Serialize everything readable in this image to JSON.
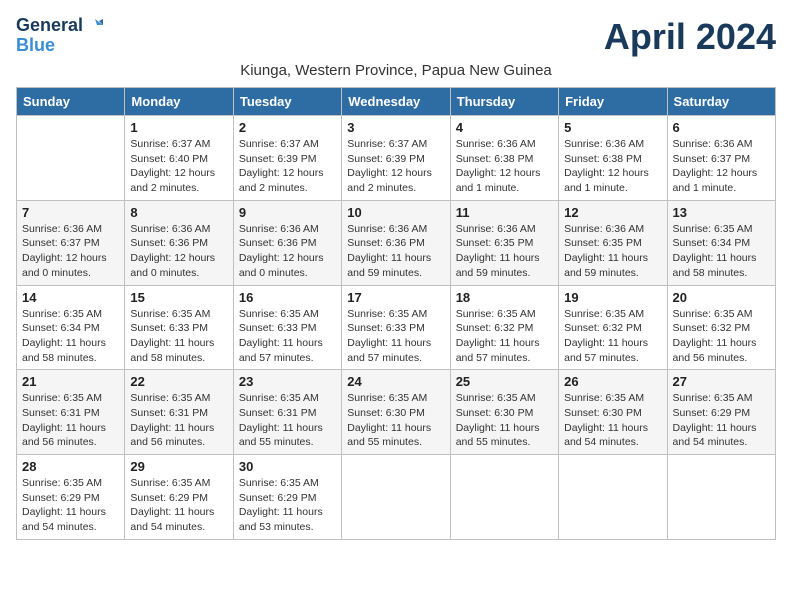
{
  "header": {
    "logo_line1": "General",
    "logo_line2": "Blue",
    "month_title": "April 2024",
    "subtitle": "Kiunga, Western Province, Papua New Guinea"
  },
  "days_of_week": [
    "Sunday",
    "Monday",
    "Tuesday",
    "Wednesday",
    "Thursday",
    "Friday",
    "Saturday"
  ],
  "weeks": [
    [
      {
        "day": "",
        "info": ""
      },
      {
        "day": "1",
        "info": "Sunrise: 6:37 AM\nSunset: 6:40 PM\nDaylight: 12 hours\nand 2 minutes."
      },
      {
        "day": "2",
        "info": "Sunrise: 6:37 AM\nSunset: 6:39 PM\nDaylight: 12 hours\nand 2 minutes."
      },
      {
        "day": "3",
        "info": "Sunrise: 6:37 AM\nSunset: 6:39 PM\nDaylight: 12 hours\nand 2 minutes."
      },
      {
        "day": "4",
        "info": "Sunrise: 6:36 AM\nSunset: 6:38 PM\nDaylight: 12 hours\nand 1 minute."
      },
      {
        "day": "5",
        "info": "Sunrise: 6:36 AM\nSunset: 6:38 PM\nDaylight: 12 hours\nand 1 minute."
      },
      {
        "day": "6",
        "info": "Sunrise: 6:36 AM\nSunset: 6:37 PM\nDaylight: 12 hours\nand 1 minute."
      }
    ],
    [
      {
        "day": "7",
        "info": "Sunrise: 6:36 AM\nSunset: 6:37 PM\nDaylight: 12 hours\nand 0 minutes."
      },
      {
        "day": "8",
        "info": "Sunrise: 6:36 AM\nSunset: 6:36 PM\nDaylight: 12 hours\nand 0 minutes."
      },
      {
        "day": "9",
        "info": "Sunrise: 6:36 AM\nSunset: 6:36 PM\nDaylight: 12 hours\nand 0 minutes."
      },
      {
        "day": "10",
        "info": "Sunrise: 6:36 AM\nSunset: 6:36 PM\nDaylight: 11 hours\nand 59 minutes."
      },
      {
        "day": "11",
        "info": "Sunrise: 6:36 AM\nSunset: 6:35 PM\nDaylight: 11 hours\nand 59 minutes."
      },
      {
        "day": "12",
        "info": "Sunrise: 6:36 AM\nSunset: 6:35 PM\nDaylight: 11 hours\nand 59 minutes."
      },
      {
        "day": "13",
        "info": "Sunrise: 6:35 AM\nSunset: 6:34 PM\nDaylight: 11 hours\nand 58 minutes."
      }
    ],
    [
      {
        "day": "14",
        "info": "Sunrise: 6:35 AM\nSunset: 6:34 PM\nDaylight: 11 hours\nand 58 minutes."
      },
      {
        "day": "15",
        "info": "Sunrise: 6:35 AM\nSunset: 6:33 PM\nDaylight: 11 hours\nand 58 minutes."
      },
      {
        "day": "16",
        "info": "Sunrise: 6:35 AM\nSunset: 6:33 PM\nDaylight: 11 hours\nand 57 minutes."
      },
      {
        "day": "17",
        "info": "Sunrise: 6:35 AM\nSunset: 6:33 PM\nDaylight: 11 hours\nand 57 minutes."
      },
      {
        "day": "18",
        "info": "Sunrise: 6:35 AM\nSunset: 6:32 PM\nDaylight: 11 hours\nand 57 minutes."
      },
      {
        "day": "19",
        "info": "Sunrise: 6:35 AM\nSunset: 6:32 PM\nDaylight: 11 hours\nand 57 minutes."
      },
      {
        "day": "20",
        "info": "Sunrise: 6:35 AM\nSunset: 6:32 PM\nDaylight: 11 hours\nand 56 minutes."
      }
    ],
    [
      {
        "day": "21",
        "info": "Sunrise: 6:35 AM\nSunset: 6:31 PM\nDaylight: 11 hours\nand 56 minutes."
      },
      {
        "day": "22",
        "info": "Sunrise: 6:35 AM\nSunset: 6:31 PM\nDaylight: 11 hours\nand 56 minutes."
      },
      {
        "day": "23",
        "info": "Sunrise: 6:35 AM\nSunset: 6:31 PM\nDaylight: 11 hours\nand 55 minutes."
      },
      {
        "day": "24",
        "info": "Sunrise: 6:35 AM\nSunset: 6:30 PM\nDaylight: 11 hours\nand 55 minutes."
      },
      {
        "day": "25",
        "info": "Sunrise: 6:35 AM\nSunset: 6:30 PM\nDaylight: 11 hours\nand 55 minutes."
      },
      {
        "day": "26",
        "info": "Sunrise: 6:35 AM\nSunset: 6:30 PM\nDaylight: 11 hours\nand 54 minutes."
      },
      {
        "day": "27",
        "info": "Sunrise: 6:35 AM\nSunset: 6:29 PM\nDaylight: 11 hours\nand 54 minutes."
      }
    ],
    [
      {
        "day": "28",
        "info": "Sunrise: 6:35 AM\nSunset: 6:29 PM\nDaylight: 11 hours\nand 54 minutes."
      },
      {
        "day": "29",
        "info": "Sunrise: 6:35 AM\nSunset: 6:29 PM\nDaylight: 11 hours\nand 54 minutes."
      },
      {
        "day": "30",
        "info": "Sunrise: 6:35 AM\nSunset: 6:29 PM\nDaylight: 11 hours\nand 53 minutes."
      },
      {
        "day": "",
        "info": ""
      },
      {
        "day": "",
        "info": ""
      },
      {
        "day": "",
        "info": ""
      },
      {
        "day": "",
        "info": ""
      }
    ]
  ]
}
